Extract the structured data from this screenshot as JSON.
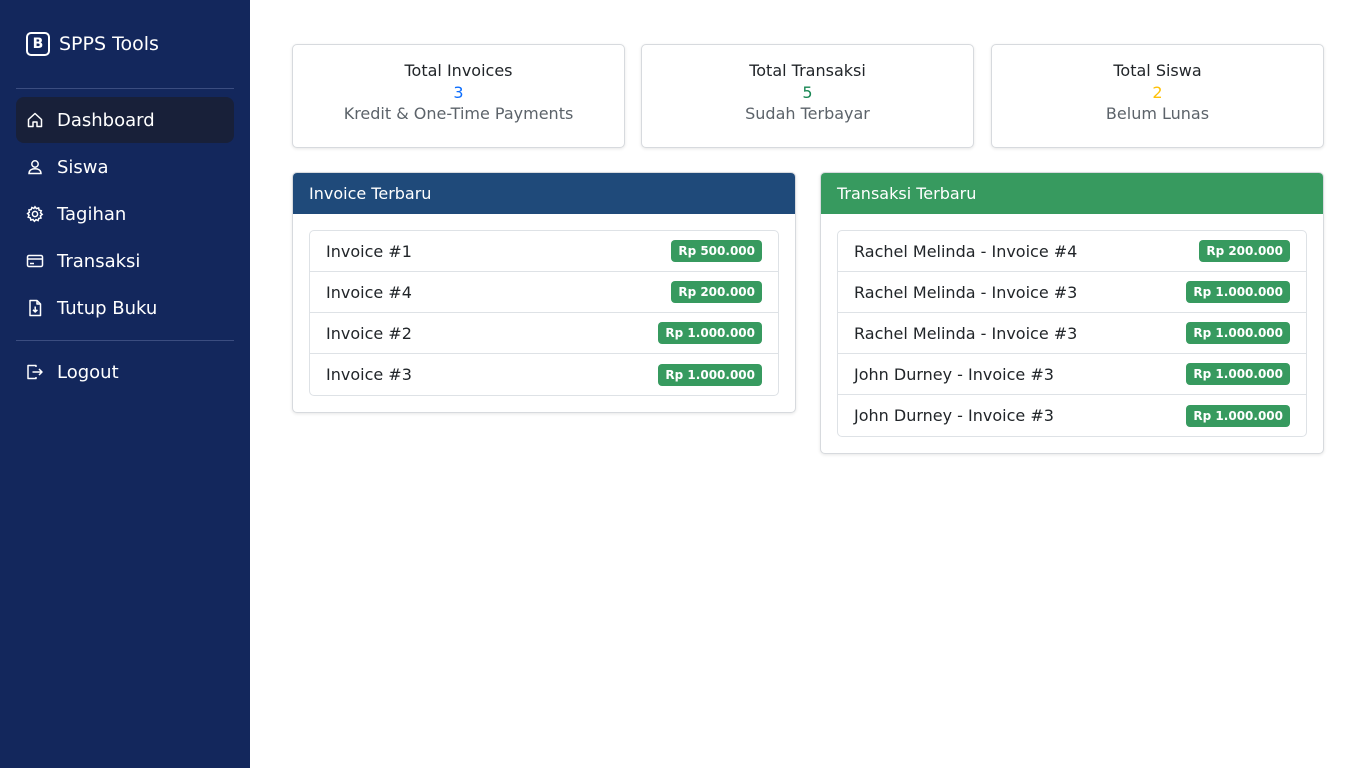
{
  "brand": {
    "icon_letter": "B",
    "name": "SPPS Tools"
  },
  "sidebar": {
    "items": [
      {
        "label": "Dashboard",
        "icon": "house-icon"
      },
      {
        "label": "Siswa",
        "icon": "person-icon"
      },
      {
        "label": "Tagihan",
        "icon": "gear-icon"
      },
      {
        "label": "Transaksi",
        "icon": "credit-card-icon"
      },
      {
        "label": "Tutup Buku",
        "icon": "file-download-icon"
      }
    ],
    "logout": {
      "label": "Logout",
      "icon": "logout-icon"
    },
    "active_index": 0
  },
  "stats": [
    {
      "title": "Total Invoices",
      "value": "3",
      "subtitle": "Kredit & One-Time Payments",
      "value_color": "#0d6efd"
    },
    {
      "title": "Total Transaksi",
      "value": "5",
      "subtitle": "Sudah Terbayar",
      "value_color": "#198754"
    },
    {
      "title": "Total Siswa",
      "value": "2",
      "subtitle": "Belum Lunas",
      "value_color": "#ffc107"
    }
  ],
  "invoice_panel": {
    "title": "Invoice Terbaru",
    "header_color": "#1f4a7a",
    "items": [
      {
        "name": "Invoice #1",
        "amount": "Rp 500.000"
      },
      {
        "name": "Invoice #4",
        "amount": "Rp 200.000"
      },
      {
        "name": "Invoice #2",
        "amount": "Rp 1.000.000"
      },
      {
        "name": "Invoice #3",
        "amount": "Rp 1.000.000"
      }
    ]
  },
  "transaction_panel": {
    "title": "Transaksi Terbaru",
    "header_color": "#379a5f",
    "items": [
      {
        "name": "Rachel Melinda - Invoice #4",
        "amount": "Rp 200.000"
      },
      {
        "name": "Rachel Melinda - Invoice #3",
        "amount": "Rp 1.000.000"
      },
      {
        "name": "Rachel Melinda - Invoice #3",
        "amount": "Rp 1.000.000"
      },
      {
        "name": "John Durney - Invoice #3",
        "amount": "Rp 1.000.000"
      },
      {
        "name": "John Durney - Invoice #3",
        "amount": "Rp 1.000.000"
      }
    ]
  },
  "colors": {
    "sidebar_bg": "#13275c",
    "active_item_bg": "#182039",
    "badge_bg": "#379a5f"
  }
}
